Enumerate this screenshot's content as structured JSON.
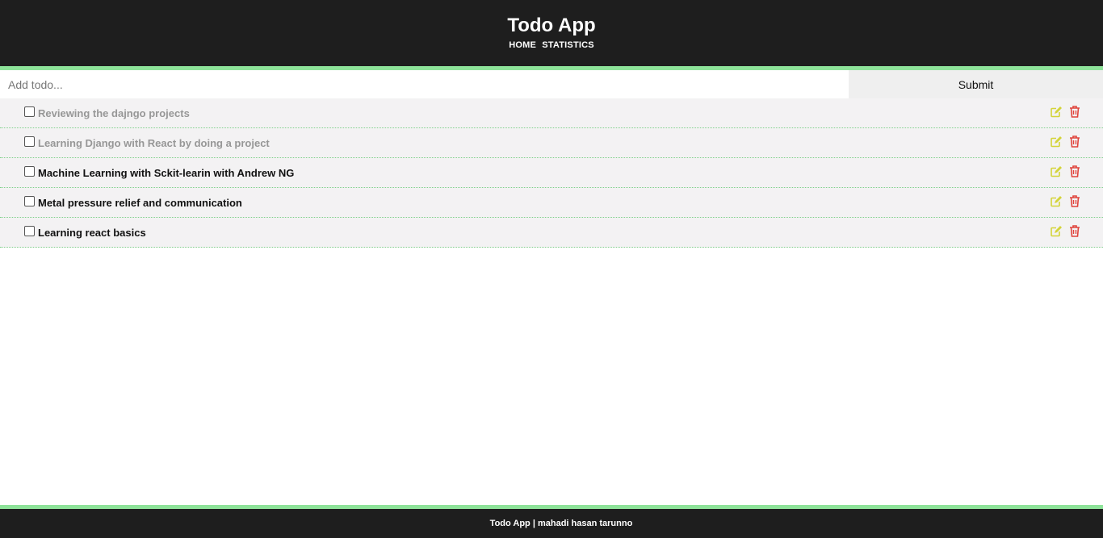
{
  "header": {
    "title": "Todo App",
    "nav": [
      "HOME",
      "STATISTICS"
    ]
  },
  "form": {
    "placeholder": "Add todo...",
    "submit_label": "Submit"
  },
  "todos": [
    {
      "text": "Reviewing the dajngo projects",
      "completed": true
    },
    {
      "text": "Learning Django with React by doing a project",
      "completed": true
    },
    {
      "text": "Machine Learning with Sckit-learin with Andrew NG",
      "completed": false
    },
    {
      "text": "Metal pressure relief and communication",
      "completed": false
    },
    {
      "text": "Learning react basics",
      "completed": false
    }
  ],
  "icons": {
    "edit": "edit-icon",
    "delete": "trash-icon"
  },
  "colors": {
    "edit": "#d4d43a",
    "delete": "#e0443c",
    "accent": "#8ee39a",
    "dark": "#1e1e1e"
  },
  "footer": {
    "text": "Todo App | mahadi hasan tarunno"
  }
}
